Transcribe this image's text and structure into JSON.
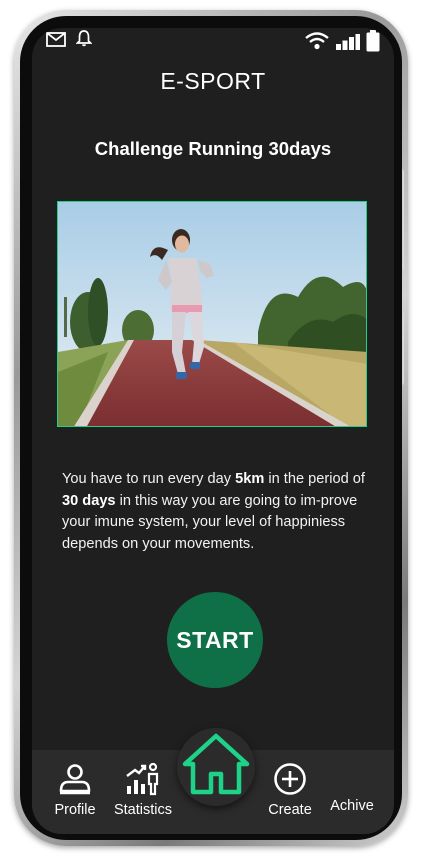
{
  "app": {
    "title": "E-SPORT"
  },
  "challenge": {
    "title": "Challenge Running 30days",
    "image_alt": "woman running on a park track",
    "desc_part1": "You have to run every day ",
    "desc_bold1": "5km",
    "desc_part2": " in the period of ",
    "desc_bold2": "30 days",
    "desc_part3": " in this way you are going to im-prove your imune system, your level of happiniess depends on your movements."
  },
  "actions": {
    "start_label": "START"
  },
  "nav": {
    "items": [
      {
        "label": "Profile",
        "icon": "profile-icon"
      },
      {
        "label": "Statistics",
        "icon": "statistics-icon"
      },
      {
        "label": "",
        "icon": "home-icon"
      },
      {
        "label": "Create",
        "icon": "plus-circle-icon"
      },
      {
        "label": "Achive",
        "icon": "achive-icon"
      }
    ]
  },
  "status": {
    "icons": [
      "mail-icon",
      "bell-icon",
      "wifi-icon",
      "signal-icon",
      "battery-icon"
    ]
  },
  "colors": {
    "screen_bg": "#1f1f1f",
    "accent_green": "#0f7048",
    "home_icon_green": "#1fd28a",
    "nav_bg": "#2b2b2b"
  }
}
